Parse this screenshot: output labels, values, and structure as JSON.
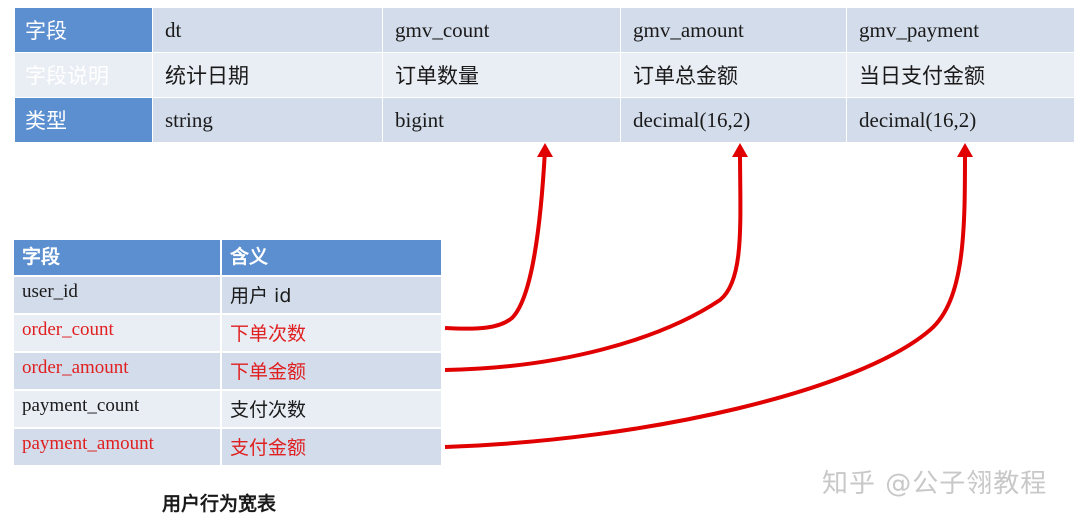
{
  "top_table": {
    "rows": [
      [
        "字段",
        "dt",
        "gmv_count",
        "gmv_amount",
        "gmv_payment"
      ],
      [
        "字段说明",
        "统计日期",
        "订单数量",
        "订单总金额",
        "当日支付金额"
      ],
      [
        "类型",
        "string",
        "bigint",
        "decimal(16,2)",
        "decimal(16,2)"
      ]
    ]
  },
  "bottom_table": {
    "header": [
      "字段",
      "含义"
    ],
    "rows": [
      {
        "field": "user_id",
        "meaning": "用户 id",
        "highlight": false
      },
      {
        "field": "order_count",
        "meaning": "下单次数",
        "highlight": true
      },
      {
        "field": "order_amount",
        "meaning": "下单金额",
        "highlight": true
      },
      {
        "field": "payment_count",
        "meaning": "支付次数",
        "highlight": false
      },
      {
        "field": "payment_amount",
        "meaning": "支付金额",
        "highlight": true
      }
    ]
  },
  "caption": "用户行为宽表",
  "watermark": "知乎 @公子翎教程",
  "colors": {
    "header_blue": "#5b8fcf",
    "row_light": "#d3dcea",
    "row_lighter": "#e9edf4",
    "highlight_red": "#e02020",
    "arrow_red": "#e00000"
  },
  "mappings": [
    {
      "from": "order_count",
      "to": "gmv_count"
    },
    {
      "from": "order_amount",
      "to": "gmv_amount"
    },
    {
      "from": "payment_amount",
      "to": "gmv_payment"
    }
  ]
}
